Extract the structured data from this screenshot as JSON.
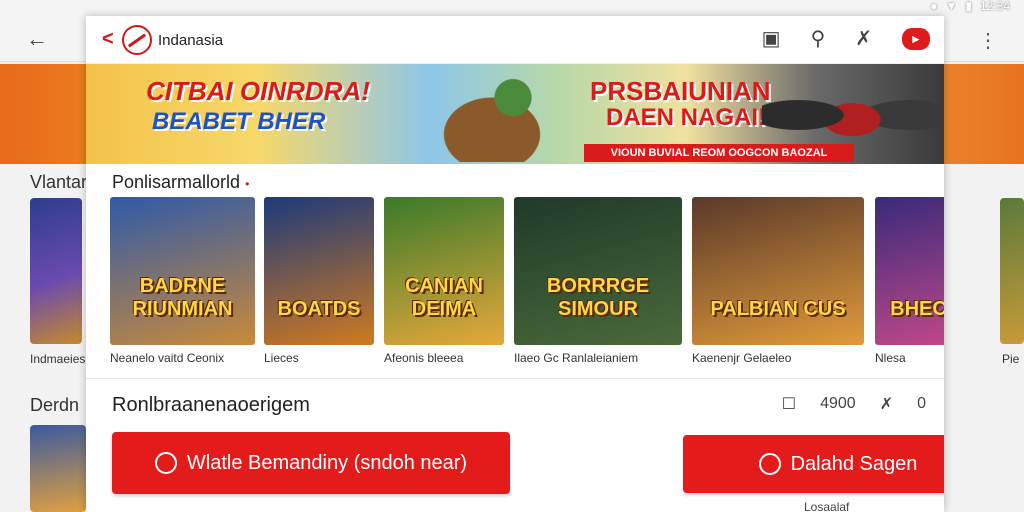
{
  "status_bar": {
    "time": "12:34"
  },
  "background": {
    "section1": "Vlantar",
    "section1_caption": "Indmaeies",
    "section2": "Derdn",
    "right_caption": "Pie"
  },
  "header": {
    "title": "Indanasia"
  },
  "banner": {
    "left_line1": "CITBAI OINRDRA!",
    "left_line2": "BEABET BHER",
    "right_line1": "PRSBAIUNIAN",
    "right_line2": "DAEN NAGAI!",
    "strip": "VIOUN BUVIAL REOM OOGCON BAOZAL"
  },
  "popular": {
    "title": "Ponlisarmallorld",
    "games": [
      {
        "label": "BADRNE RIUNMIAN",
        "caption": "Neanelo vaitd Ceonix",
        "color1": "#2f5aa8",
        "color2": "#c98a3a"
      },
      {
        "label": "BOATDS",
        "caption": "Lieces",
        "color1": "#1d3a7a",
        "color2": "#d07a20"
      },
      {
        "label": "CANIAN DEIMA",
        "caption": "Afeonis bleeea",
        "color1": "#3a7a2a",
        "color2": "#e6a83a"
      },
      {
        "label": "BORRRGE SIMOUR",
        "caption": "Ilaeo Gc Ranlaleianiem",
        "color1": "#1f3a2a",
        "color2": "#4a6a3a"
      },
      {
        "label": "PALBIAN CUS",
        "caption": "Kaenenjr Gelaeleo",
        "color1": "#5a3a2a",
        "color2": "#e09a3a"
      },
      {
        "label": "BHECSM",
        "caption": "Nlesa",
        "color1": "#3a2a7a",
        "color2": "#c84a8a"
      }
    ]
  },
  "promo": {
    "title": "Ronlbraanenaoerigem",
    "likes": "4900",
    "shares": "0"
  },
  "buttons": {
    "primary": "Wlatle Bemandiny (sndoh near)",
    "secondary": "Dalahd Sagen",
    "secondary_subtext": "Losaalaf"
  },
  "colors": {
    "accent": "#e31b1b",
    "brand": "#d01818"
  }
}
